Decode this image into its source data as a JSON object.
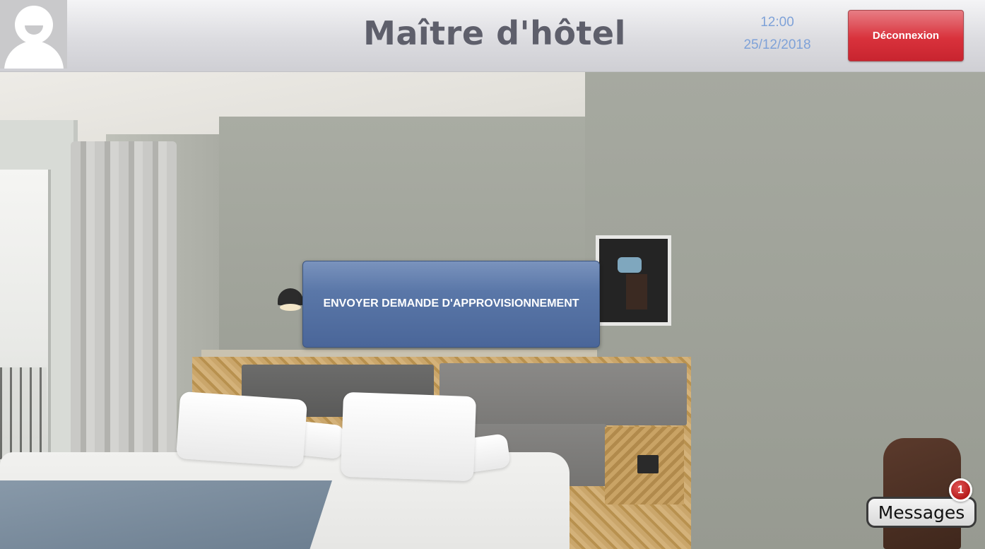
{
  "header": {
    "title": "Maître d'hôtel",
    "time": "12:00",
    "date": "25/12/2018",
    "logout_label": "Déconnexion"
  },
  "main": {
    "supply_request_label": "ENVOYER DEMANDE D'APPROVISIONNEMENT"
  },
  "messages": {
    "label": "Messages",
    "unread_count": "1"
  },
  "colors": {
    "logout_red": "#d9323c",
    "action_blue": "#5a77a8",
    "clock_blue": "#7fa2d8",
    "title_gray": "#5e5f6b"
  },
  "icons": {
    "avatar": "user-avatar-icon"
  }
}
